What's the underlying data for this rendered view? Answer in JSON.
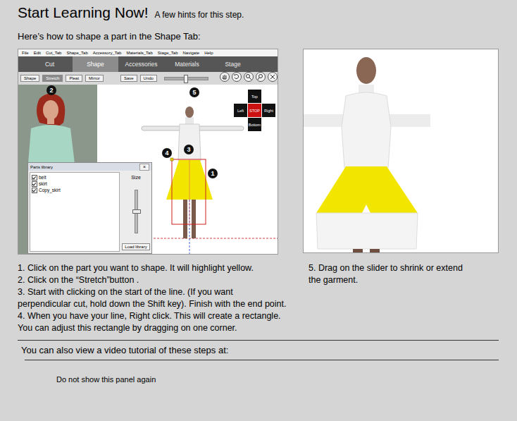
{
  "header": {
    "title": "Start Learning Now!",
    "subtitle": "A few hints for this step."
  },
  "intro": "Here’s how to shape a part in the Shape Tab:",
  "app": {
    "menu": [
      "File",
      "Edit",
      "Cut_Tab",
      "Shape_Tab",
      "Accessory_Tab",
      "Materials_Tab",
      "Stage_Tab",
      "Navigate",
      "Help"
    ],
    "tabs": [
      {
        "label": "Cut",
        "selected": false
      },
      {
        "label": "Shape",
        "selected": true
      },
      {
        "label": "Accessories",
        "selected": false
      },
      {
        "label": "Materials",
        "selected": false
      },
      {
        "label": "Stage",
        "selected": false
      }
    ],
    "toolbar_buttons": [
      {
        "label": "Shape",
        "selected": false
      },
      {
        "label": "Stretch",
        "selected": true
      },
      {
        "label": "Pleat",
        "selected": false
      },
      {
        "label": "Mirror",
        "selected": false
      },
      {
        "label": "Save",
        "selected": false
      },
      {
        "label": "Undo",
        "selected": false
      }
    ],
    "zoom_slider": {
      "level": 0.5
    },
    "nav_pad": [
      {
        "label": "Top",
        "color": "#111111"
      },
      {
        "label": "Left",
        "color": "#111111"
      },
      {
        "label": "STOP",
        "color": "#cc1111"
      },
      {
        "label": "Right",
        "color": "#111111"
      },
      {
        "label": "Bottom",
        "color": "#111111"
      }
    ],
    "callouts": [
      "1",
      "2",
      "3",
      "4",
      "5"
    ],
    "parts_library": {
      "title": "Parts library",
      "close": "×",
      "items": [
        {
          "label": "belt",
          "checked": true
        },
        {
          "label": "skirt",
          "checked": true
        },
        {
          "label": "Copy_skirt",
          "checked": true
        }
      ],
      "size_label": "Size",
      "size_slider": {
        "level": 0.5
      },
      "load_button": "Load library"
    }
  },
  "steps": [
    "1. Click on the part you want to shape. It will highlight yellow.",
    "2. Click on the “Stretch”button .",
    "3. Start with clicking on the start of the line. (If you want",
    "perpendicular cut, hold down the Shift key). Finish with the end point.",
    "4. When you have your line, Right click. This will create a rectangle.",
    "You can adjust this rectangle by dragging on one corner."
  ],
  "step5": [
    "5. Drag on the slider to shrink or extend",
    "the garment."
  ],
  "video_text": "You can also view a video tutorial of these steps at:",
  "dont_show": "Do not show this panel again"
}
